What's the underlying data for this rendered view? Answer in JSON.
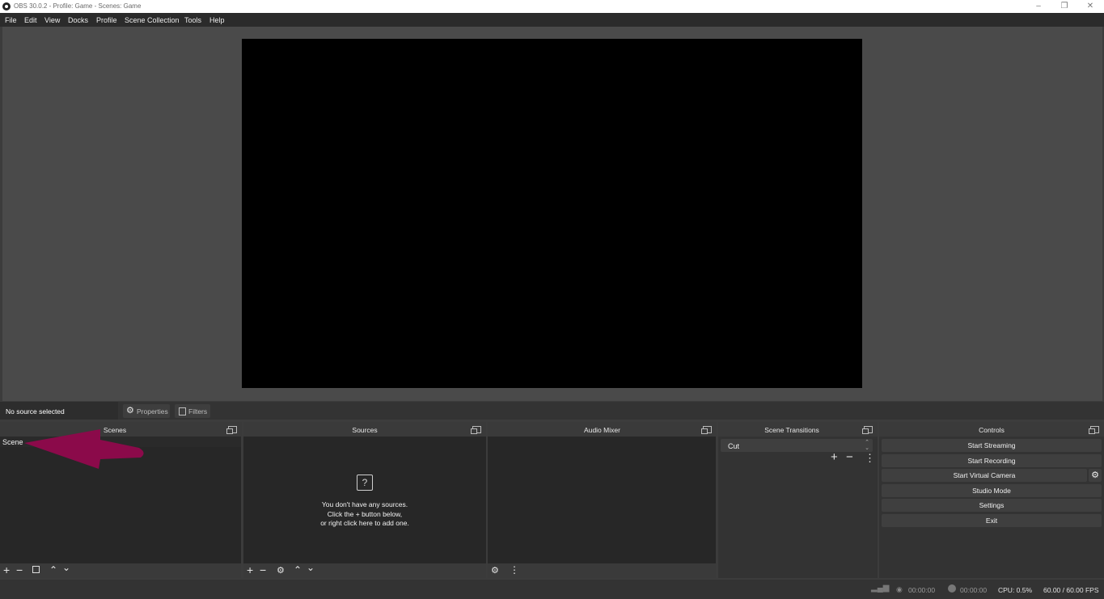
{
  "window": {
    "title": "OBS 30.0.2 - Profile: Game - Scenes: Game"
  },
  "menu": [
    "File",
    "Edit",
    "View",
    "Docks",
    "Profile",
    "Scene Collection",
    "Tools",
    "Help"
  ],
  "source_toolbar": {
    "status": "No source selected",
    "properties": "Properties",
    "filters": "Filters"
  },
  "docks": {
    "scenes": {
      "title": "Scenes",
      "items": [
        "Scene"
      ]
    },
    "sources": {
      "title": "Sources",
      "empty_line1": "You don't have any sources.",
      "empty_line2": "Click the + button below,",
      "empty_line3": "or right click here to add one."
    },
    "audio_mixer": {
      "title": "Audio Mixer"
    },
    "scene_transitions": {
      "title": "Scene Transitions",
      "selected": "Cut"
    },
    "controls": {
      "title": "Controls",
      "buttons": [
        "Start Streaming",
        "Start Recording",
        "Start Virtual Camera",
        "Studio Mode",
        "Settings",
        "Exit"
      ]
    }
  },
  "status": {
    "stream_time": "00:00:00",
    "rec_time": "00:00:00",
    "cpu": "CPU: 0.5%",
    "fps": "60.00 / 60.00 FPS"
  },
  "colors": {
    "annotation_arrow": "#8b0a4a",
    "canvas": "#000000"
  }
}
